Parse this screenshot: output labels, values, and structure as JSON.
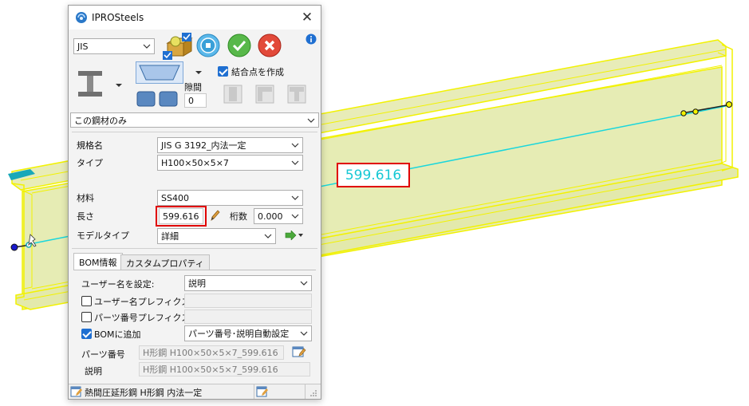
{
  "dialog": {
    "title": "IPROSteels",
    "standard": "JIS",
    "joint_label": "結合点を作成",
    "joint_checked": true,
    "gap_label": "隙間",
    "gap_value": "0",
    "scope": "この鋼材のみ"
  },
  "properties": {
    "spec_label": "規格名",
    "spec_value": "JIS G 3192_内法一定",
    "type_label": "タイプ",
    "type_value": "H100×50×5×7",
    "material_label": "材料",
    "material_value": "SS400",
    "length_label": "長さ",
    "length_value": "599.616",
    "digits_label": "桁数",
    "digits_value": "0.000",
    "model_type_label": "モデルタイプ",
    "model_type_value": "詳細"
  },
  "tabs": [
    "BOM情報",
    "カスタムプロパティ"
  ],
  "bom": {
    "username_label": "ユーザー名を設定:",
    "username_value": "説明",
    "username_prefix_label": "ユーザー名プレフィクス",
    "part_prefix_label": "パーツ番号プレフィクス",
    "add_bom_label": "BOMに追加",
    "add_bom_value": "パーツ番号･説明自動設定",
    "part_number_label": "パーツ番号",
    "part_number_value": "H形鋼 H100×50×5×7_599.616",
    "description_label": "説明",
    "description_value": "H形鋼 H100×50×5×7_599.616"
  },
  "status": {
    "text": "熱間圧延形鋼 H形鋼 内法一定"
  },
  "viewport": {
    "dimension": "599.616"
  },
  "colors": {
    "beam_fill": "#e6ecb4",
    "beam_edge": "#f2f200",
    "dimension_line": "#19d6dc",
    "highlight": "#e00000",
    "accent": "#1f6fd1"
  },
  "icons": [
    "app-logo-icon",
    "close-icon",
    "info-icon",
    "apply-icon",
    "ok-icon",
    "cancel-icon",
    "h-beam-icon",
    "edit-pencil-icon",
    "arrow-icon"
  ]
}
